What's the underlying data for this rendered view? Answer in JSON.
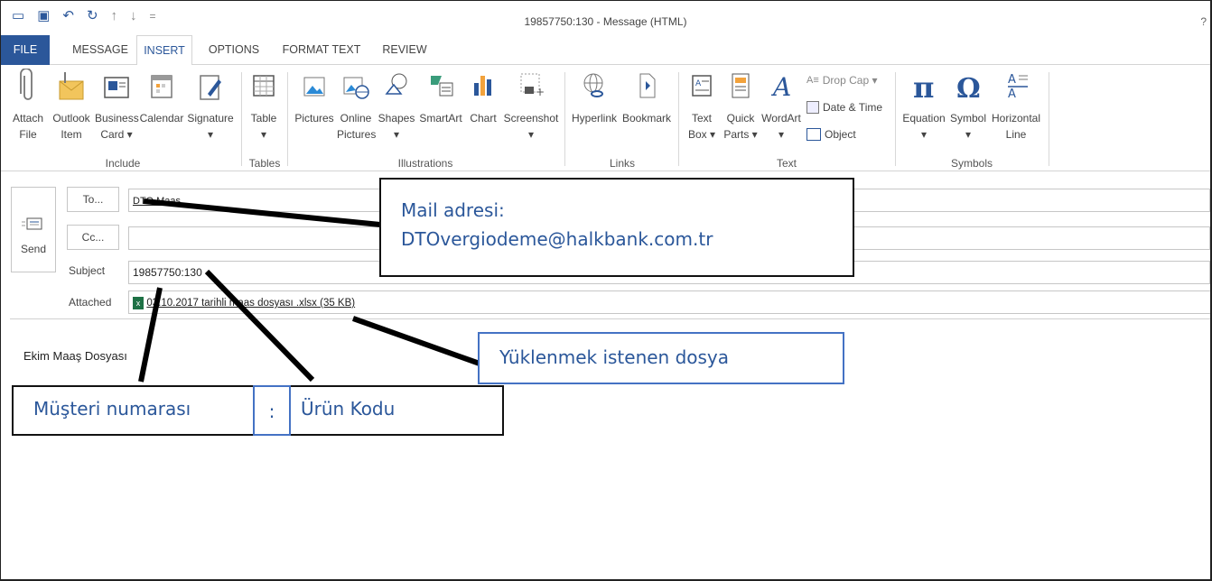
{
  "window": {
    "title": "19857750:130 - Message (HTML)",
    "help": "?"
  },
  "tabs": [
    "FILE",
    "MESSAGE",
    "INSERT",
    "OPTIONS",
    "FORMAT TEXT",
    "REVIEW"
  ],
  "ribbon": {
    "attach_file": [
      "Attach",
      "File"
    ],
    "outlook_item": [
      "Outlook",
      "Item"
    ],
    "business_card": [
      "Business",
      "Card ▾"
    ],
    "calendar": "Calendar",
    "signature": "Signature",
    "include_label": "Include",
    "table": "Table",
    "tables_label": "Tables",
    "pictures": "Pictures",
    "online_pictures": [
      "Online",
      "Pictures"
    ],
    "shapes": "Shapes",
    "smartart": "SmartArt",
    "chart": "Chart",
    "screenshot": "Screenshot",
    "illustrations_label": "Illustrations",
    "hyperlink": "Hyperlink",
    "bookmark": "Bookmark",
    "links_label": "Links",
    "text_box": [
      "Text",
      "Box ▾"
    ],
    "quick_parts": [
      "Quick",
      "Parts ▾"
    ],
    "wordart": "WordArt",
    "drop_cap": "Drop Cap ▾",
    "date_time": "Date & Time",
    "object": "Object",
    "text_label": "Text",
    "equation": "Equation",
    "symbol": "Symbol",
    "horizontal_line": [
      "Horizontal",
      "Line"
    ],
    "symbols_label": "Symbols"
  },
  "compose": {
    "send": "Send",
    "to_button": "To...",
    "cc_button": "Cc...",
    "to_value": "DTO Maas",
    "subject_label": "Subject",
    "subject_value": "19857750:130",
    "attached_label": "Attached",
    "attachment": "03.10.2017 tarihli maas dosyası .xlsx (35 KB)",
    "body": "Ekim Maaş Dosyası"
  },
  "annotations": {
    "mail_line1": "Mail adresi:",
    "mail_line2": "DTOvergiodeme@halkbank.com.tr",
    "file_note": "Yüklenmek istenen dosya",
    "customer_number": "Müşteri numarası",
    "colon": ":",
    "product_code": "Ürün Kodu"
  },
  "colors": {
    "accent": "#2b579a",
    "annotation_border_blue": "#4472c4",
    "annotation_border_black": "#111111"
  }
}
